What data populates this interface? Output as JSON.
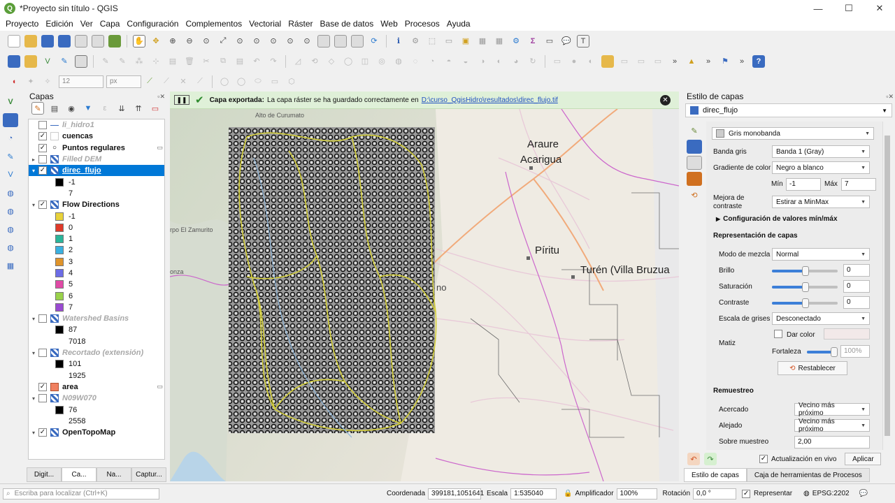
{
  "window": {
    "title": "*Proyecto sin título - QGIS",
    "logo": "Q",
    "minimize": "—",
    "maximize": "☐",
    "close": "✕"
  },
  "menu": [
    "Proyecto",
    "Edición",
    "Ver",
    "Capa",
    "Configuración",
    "Complementos",
    "Vectorial",
    "Ráster",
    "Base de datos",
    "Web",
    "Procesos",
    "Ayuda"
  ],
  "digitize_toolbar": {
    "size_value": "12",
    "unit": "px"
  },
  "layers_panel": {
    "title": "Capas",
    "items": [
      {
        "label": "li_hidro1",
        "checked": false,
        "dim": true,
        "kind": "line"
      },
      {
        "label": "cuencas",
        "checked": true,
        "kind": "polygon"
      },
      {
        "label": "Puntos regulares",
        "checked": true,
        "kind": "point"
      },
      {
        "label": "Filled DEM",
        "checked": false,
        "dim": true,
        "kind": "raster",
        "expand": "▸"
      },
      {
        "label": "direc_flujo",
        "checked": true,
        "selected": true,
        "kind": "raster",
        "expand": "▾"
      },
      {
        "label": "-1",
        "swatch": "#000000",
        "sub": true
      },
      {
        "label": "7",
        "swatch": "#ffffff",
        "sub": true,
        "noswatch": true
      },
      {
        "label": "Flow Directions",
        "checked": true,
        "kind": "raster",
        "expand": "▾"
      },
      {
        "label": "-1",
        "swatch": "#e8d23a",
        "sub": true
      },
      {
        "label": "0",
        "swatch": "#e03a2a",
        "sub": true
      },
      {
        "label": "1",
        "swatch": "#2ab59a",
        "sub": true
      },
      {
        "label": "2",
        "swatch": "#3ab0e0",
        "sub": true
      },
      {
        "label": "3",
        "swatch": "#e0942a",
        "sub": true
      },
      {
        "label": "4",
        "swatch": "#6c6ce6",
        "sub": true
      },
      {
        "label": "5",
        "swatch": "#e04aa6",
        "sub": true
      },
      {
        "label": "6",
        "swatch": "#9ad24a",
        "sub": true
      },
      {
        "label": "7",
        "swatch": "#9a4ad2",
        "sub": true
      },
      {
        "label": "Watershed Basins",
        "checked": false,
        "dim": true,
        "kind": "raster",
        "expand": "▾"
      },
      {
        "label": "87",
        "swatch": "#000000",
        "sub": true
      },
      {
        "label": "7018",
        "swatch": "#ffffff",
        "sub": true,
        "noswatch": true
      },
      {
        "label": "Recortado (extensión)",
        "checked": false,
        "dim": true,
        "kind": "raster",
        "expand": "▾"
      },
      {
        "label": "101",
        "swatch": "#000000",
        "sub": true
      },
      {
        "label": "1925",
        "swatch": "#ffffff",
        "sub": true,
        "noswatch": true
      },
      {
        "label": "area",
        "checked": true,
        "kind": "polygon-orange"
      },
      {
        "label": "N09W070",
        "checked": false,
        "dim": true,
        "kind": "raster",
        "expand": "▾"
      },
      {
        "label": "76",
        "swatch": "#000000",
        "sub": true
      },
      {
        "label": "2558",
        "swatch": "#ffffff",
        "sub": true,
        "noswatch": true
      },
      {
        "label": "OpenTopoMap",
        "checked": true,
        "kind": "raster",
        "expand": "▾"
      }
    ],
    "bottom_tabs": [
      "Digit...",
      "Ca...",
      "Na...",
      "Captur..."
    ]
  },
  "message_bar": {
    "heading": "Capa exportada:",
    "text": "La capa ráster se ha guardado correctamente en",
    "link": "D:\\curso_QgisHidro\\resultados\\direc_flujo.tif",
    "close": "✕"
  },
  "map_labels": {
    "alto": "Alto de Curumato",
    "araure": "Araure",
    "acarigua": "Acarigua",
    "piritu": "Píritu",
    "turen": "Turén (Villa Bruzua",
    "zamurito": "rpo El Zamurito",
    "onza": "onza",
    "no": "no"
  },
  "style_panel": {
    "title": "Estilo de capas",
    "layer": "direc_flujo",
    "render_type": "Gris monobanda",
    "banda_label": "Banda gris",
    "banda_value": "Banda 1 (Gray)",
    "gradiente_label": "Gradiente de color",
    "gradiente_value": "Negro a blanco",
    "min_label": "Mín",
    "min_value": "-1",
    "max_label": "Máx",
    "max_value": "7",
    "mejora_label": "Mejora de contraste",
    "mejora_value": "Estirar a MinMax",
    "config_minmax": "Configuración de valores mín/máx",
    "representacion": "Representación de capas",
    "modo_label": "Modo de mezcla",
    "modo_value": "Normal",
    "brillo_label": "Brillo",
    "brillo_value": "0",
    "saturacion_label": "Saturación",
    "saturacion_value": "0",
    "contraste_label": "Contraste",
    "contraste_value": "0",
    "escala_label": "Escala de grises",
    "escala_value": "Desconectado",
    "matiz_label": "Matiz",
    "dar_color": "Dar color",
    "fortaleza_label": "Fortaleza",
    "fortaleza_value": "100%",
    "restablecer": "Restablecer",
    "remuestreo": "Remuestreo",
    "acercado_label": "Acercado",
    "acercado_value": "Vecino más próximo",
    "alejado_label": "Alejado",
    "alejado_value": "Vecino más próximo",
    "sobre_label": "Sobre muestreo",
    "sobre_value": "2,00",
    "live_update": "Actualización en vivo",
    "aplicar": "Aplicar",
    "tabs": [
      "Estilo de capas",
      "Caja de herramientas de Procesos"
    ]
  },
  "status": {
    "locator_placeholder": "Escriba para localizar (Ctrl+K)",
    "coord_label": "Coordenada",
    "coord_value": "399181,1051641",
    "scale_label": "Escala",
    "scale_value": "1:535040",
    "magnifier_label": "Amplificador",
    "magnifier_value": "100%",
    "rotation_label": "Rotación",
    "rotation_value": "0,0 °",
    "render_label": "Representar",
    "crs": "EPSG:2202"
  },
  "colors": {
    "selection": "#0078d7",
    "msg_bg": "#dff0d8",
    "link": "#2050c0"
  }
}
